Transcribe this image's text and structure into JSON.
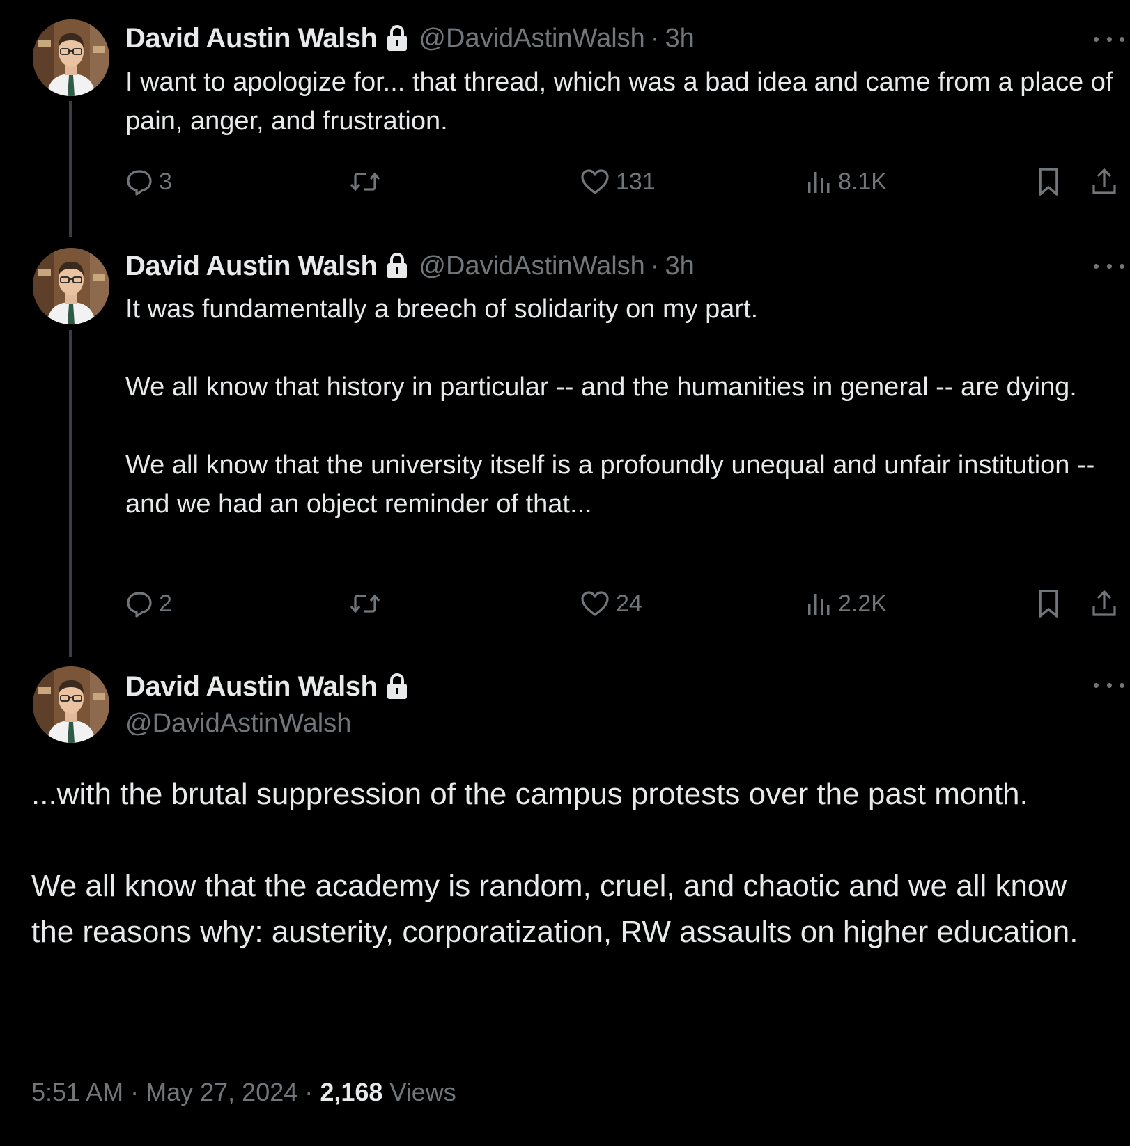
{
  "author": {
    "name": "David Austin Walsh",
    "handle": "@DavidAstinWalsh"
  },
  "colors": {
    "background": "#000000",
    "text": "#e7e9ea",
    "secondary": "#71767b"
  },
  "tweets": [
    {
      "time": "3h",
      "separator": "·",
      "paragraphs": [
        "I want to apologize for... that thread, which was a bad idea and came from a place of pain, anger, and frustration."
      ],
      "replies": "3",
      "likes": "131",
      "views": "8.1K"
    },
    {
      "time": "3h",
      "separator": "·",
      "paragraphs": [
        "It was fundamentally a breech of solidarity on my part.",
        "We all know that history in particular -- and the humanities in general -- are dying.",
        "We all know that the university itself is a profoundly unequal and unfair institution -- and we had an object reminder of that..."
      ],
      "replies": "2",
      "likes": "24",
      "views": "2.2K"
    }
  ],
  "main_tweet": {
    "paragraphs": [
      "...with the brutal suppression of the campus protests over the past month.",
      "We all know that the academy is random, cruel, and chaotic and we all know the reasons why: austerity, corporatization, RW assaults on higher education."
    ],
    "time": "5:51 AM",
    "date": "May 27, 2024",
    "sep1": "·",
    "sep2": "·",
    "view_count": "2,168",
    "views_label": "Views"
  },
  "icons": {
    "lock": "lock-icon",
    "more": "more-icon",
    "reply": "reply-icon",
    "retweet": "retweet-icon",
    "like": "heart-icon",
    "views": "views-icon",
    "bookmark": "bookmark-icon",
    "share": "share-icon"
  }
}
